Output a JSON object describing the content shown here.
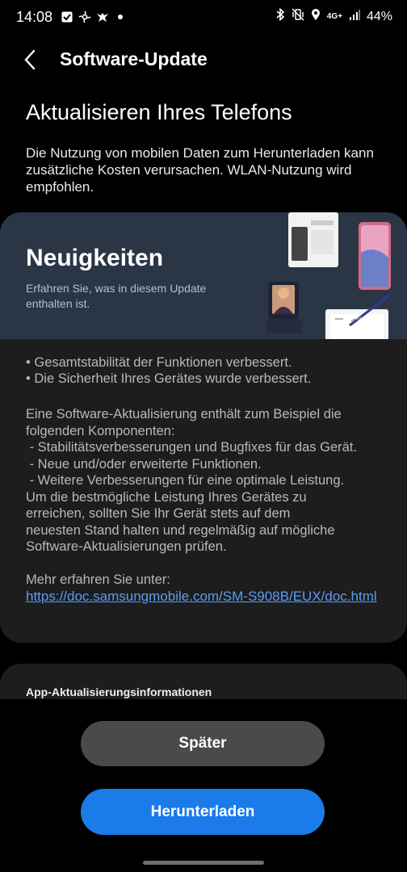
{
  "status_bar": {
    "time": "14:08",
    "battery": "44%",
    "network": "4G+",
    "icons": [
      "check-box-icon",
      "pinwheel-icon",
      "bird-icon",
      "dot-icon",
      "bluetooth-icon",
      "vibrate-icon",
      "location-icon",
      "signal-icon",
      "battery-icon"
    ]
  },
  "header": {
    "title": "Software-Update"
  },
  "main": {
    "heading": "Aktualisieren Ihres Telefons",
    "intro": "Die Nutzung von mobilen Daten zum Herunterladen kann zusätzliche Kosten verursachen. WLAN-Nutzung wird empfohlen."
  },
  "banner": {
    "title": "Neuigkeiten",
    "subtitle": "Erfahren Sie, was in diesem Update enthalten ist."
  },
  "details": {
    "bullets": [
      "• Gesamtstabilität der Funktionen verbessert.",
      "• Die Sicherheit Ihres Gerätes wurde verbessert."
    ],
    "description_lines": [
      "Eine Software-Aktualisierung enthält zum Beispiel die",
      "folgenden Komponenten:",
      " - Stabilitätsverbesserungen und Bugfixes für das Gerät.",
      " - Neue und/oder erweiterte Funktionen.",
      " - Weitere Verbesserungen für eine optimale Leistung.",
      "Um die bestmögliche Leistung Ihres Gerätes zu",
      "erreichen, sollten Sie Ihr Gerät stets auf dem",
      "neuesten Stand halten und regelmäßig auf mögliche",
      "Software-Aktualisierungen prüfen."
    ],
    "more_label": "Mehr erfahren Sie unter:",
    "link": "https://doc.samsungmobile.com/SM-S908B/EUX/doc.html"
  },
  "app_updates": {
    "label": "App-Aktualisierungsinformationen"
  },
  "buttons": {
    "later": "Später",
    "download": "Herunterladen"
  },
  "colors": {
    "background": "#000000",
    "card": "#1d1d1d",
    "banner": "#2a3645",
    "link": "#5b9cf2",
    "primary_button": "#1a7be9",
    "secondary_button": "#4a4a4a"
  }
}
